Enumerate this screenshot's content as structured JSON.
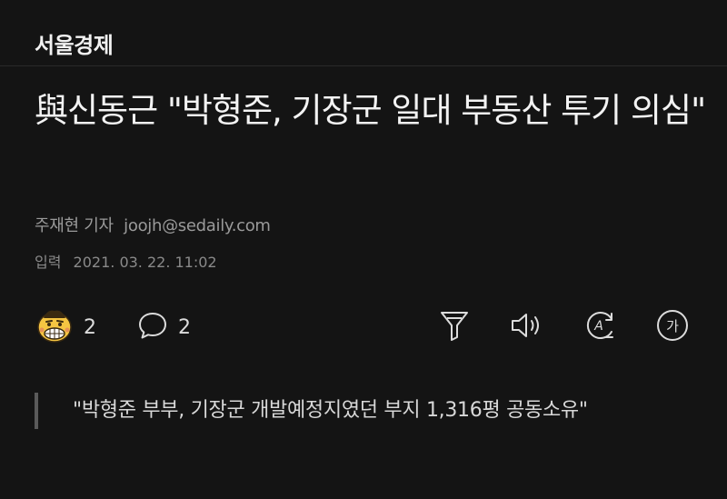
{
  "press": {
    "name": "서울경제"
  },
  "article": {
    "title": "與신동근 \"박형준, 기장군 일대 부동산 투기 의심\"",
    "reporter": "주재현 기자",
    "email": "joojh@sedaily.com",
    "date_label": "입력",
    "date_value": "2021. 03. 22. 11:02",
    "subheading": "\"박형준 부부, 기장군 개발예정지였던 부지 1,316평 공동소유\""
  },
  "reactions": {
    "emoji_count": "2",
    "comment_count": "2"
  },
  "toolbar": {
    "icons": [
      "filter-icon",
      "speaker-icon",
      "translate-icon",
      "font-size-icon"
    ],
    "font_button_label": "가",
    "translate_letter": "A"
  },
  "colors": {
    "background": "#141414",
    "text": "#f3f3f3",
    "muted": "#9a9a9a",
    "emoji_yellow": "#f5c542"
  }
}
